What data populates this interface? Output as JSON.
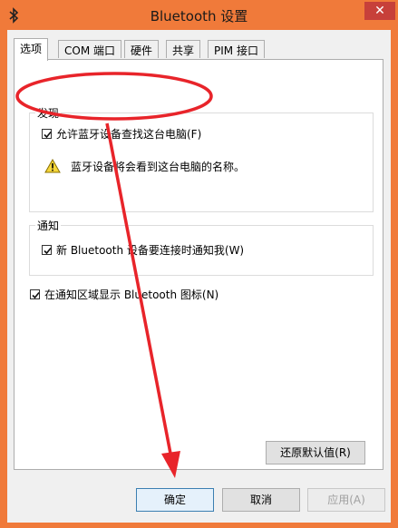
{
  "window": {
    "title": "Bluetooth 设置",
    "close_label": "✕"
  },
  "tabs": [
    {
      "label": "选项",
      "active": true
    },
    {
      "label": "COM 端口",
      "active": false
    },
    {
      "label": "硬件",
      "active": false
    },
    {
      "label": "共享",
      "active": false
    },
    {
      "label": "PIM 接口",
      "active": false
    }
  ],
  "discovery": {
    "group_title": "发现",
    "allow_find_label": "允许蓝牙设备查找这台电脑(F)",
    "allow_find_checked": true,
    "warning_text": "蓝牙设备将会看到这台电脑的名称。"
  },
  "notification": {
    "group_title": "通知",
    "notify_label": "新 Bluetooth 设备要连接时通知我(W)",
    "notify_checked": true
  },
  "tray_icon": {
    "label": "在通知区域显示 Bluetooth 图标(N)",
    "checked": true
  },
  "buttons": {
    "restore_defaults": "还原默认值(R)",
    "ok": "确定",
    "cancel": "取消",
    "apply": "应用(A)"
  },
  "colors": {
    "titlebar": "#f07a3a",
    "close": "#c7403a",
    "annotation": "#e8242a"
  }
}
